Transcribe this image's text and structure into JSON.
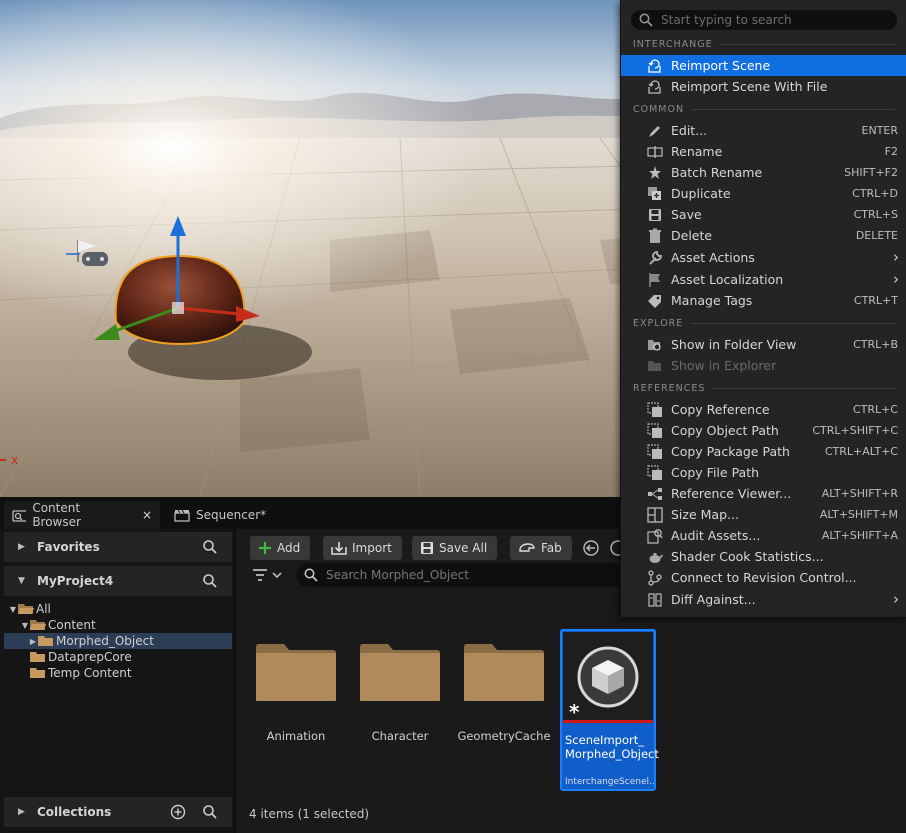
{
  "viewport": {
    "axis_label": "x"
  },
  "content_browser": {
    "tabs": [
      {
        "label": "Content Browser",
        "close": "×",
        "icon": "content-browser-icon"
      },
      {
        "label": "Sequencer*",
        "icon": "clapperboard-icon"
      }
    ],
    "sections": {
      "favorites": "Favorites",
      "project": "MyProject4",
      "collections": "Collections"
    },
    "tree": [
      {
        "label": "All",
        "expanded": true
      },
      {
        "label": "Content",
        "expanded": true
      },
      {
        "label": "Morphed_Object",
        "selected": true
      },
      {
        "label": "DataprepCore"
      },
      {
        "label": "Temp Content"
      }
    ],
    "toolbar": {
      "add": "Add",
      "import": "Import",
      "save_all": "Save All",
      "fab": "Fab"
    },
    "search_placeholder": "Search Morphed_Object",
    "folders": [
      {
        "label": "Animation"
      },
      {
        "label": "Character"
      },
      {
        "label": "GeometryCache"
      }
    ],
    "selected_asset": {
      "name_line1": "SceneImport_",
      "name_line2": "Morphed_Object",
      "type": "InterchangeScenel..."
    },
    "status": "4 items (1 selected)"
  },
  "context_menu": {
    "search_placeholder": "Start typing to search",
    "sections": [
      {
        "header": "INTERCHANGE",
        "items": [
          {
            "label": "Reimport Scene",
            "shortcut": "",
            "icon": "reimport-icon",
            "highlighted": true
          },
          {
            "label": "Reimport Scene With File",
            "shortcut": "",
            "icon": "reimport-icon"
          }
        ]
      },
      {
        "header": "COMMON",
        "items": [
          {
            "label": "Edit...",
            "shortcut": "ENTER",
            "icon": "pencil-icon"
          },
          {
            "label": "Rename",
            "shortcut": "F2",
            "icon": "rename-icon"
          },
          {
            "label": "Batch Rename",
            "shortcut": "SHIFT+F2",
            "icon": "batch-rename-icon"
          },
          {
            "label": "Duplicate",
            "shortcut": "CTRL+D",
            "icon": "duplicate-icon"
          },
          {
            "label": "Save",
            "shortcut": "CTRL+S",
            "icon": "save-icon"
          },
          {
            "label": "Delete",
            "shortcut": "DELETE",
            "icon": "trash-icon"
          },
          {
            "label": "Asset Actions",
            "shortcut": "",
            "icon": "wrench-icon",
            "submenu": true
          },
          {
            "label": "Asset Localization",
            "shortcut": "",
            "icon": "flag-icon",
            "submenu": true
          },
          {
            "label": "Manage Tags",
            "shortcut": "CTRL+T",
            "icon": "tag-icon"
          }
        ]
      },
      {
        "header": "EXPLORE",
        "items": [
          {
            "label": "Show in Folder View",
            "shortcut": "CTRL+B",
            "icon": "folder-search-icon"
          },
          {
            "label": "Show in Explorer",
            "shortcut": "",
            "icon": "folder-icon",
            "disabled": true
          }
        ]
      },
      {
        "header": "REFERENCES",
        "items": [
          {
            "label": "Copy Reference",
            "shortcut": "CTRL+C",
            "icon": "copy-icon"
          },
          {
            "label": "Copy Object Path",
            "shortcut": "CTRL+SHIFT+C",
            "icon": "copy-icon"
          },
          {
            "label": "Copy Package Path",
            "shortcut": "CTRL+ALT+C",
            "icon": "copy-icon"
          },
          {
            "label": "Copy File Path",
            "shortcut": "",
            "icon": "copy-icon"
          },
          {
            "label": "Reference Viewer...",
            "shortcut": "ALT+SHIFT+R",
            "icon": "reference-viewer-icon"
          },
          {
            "label": "Size Map...",
            "shortcut": "ALT+SHIFT+M",
            "icon": "size-map-icon"
          },
          {
            "label": "Audit Assets...",
            "shortcut": "ALT+SHIFT+A",
            "icon": "audit-icon"
          },
          {
            "label": "Shader Cook Statistics...",
            "shortcut": "",
            "icon": "teapot-icon"
          },
          {
            "label": "Connect to Revision Control...",
            "shortcut": "",
            "icon": "revision-control-icon"
          },
          {
            "label": "Diff Against...",
            "shortcut": "",
            "icon": "diff-icon",
            "submenu": true
          }
        ]
      }
    ]
  },
  "colors": {
    "highlight": "#0f6ee0",
    "selection_tile": "#0f5ec9",
    "folder": "#b08a5a"
  }
}
